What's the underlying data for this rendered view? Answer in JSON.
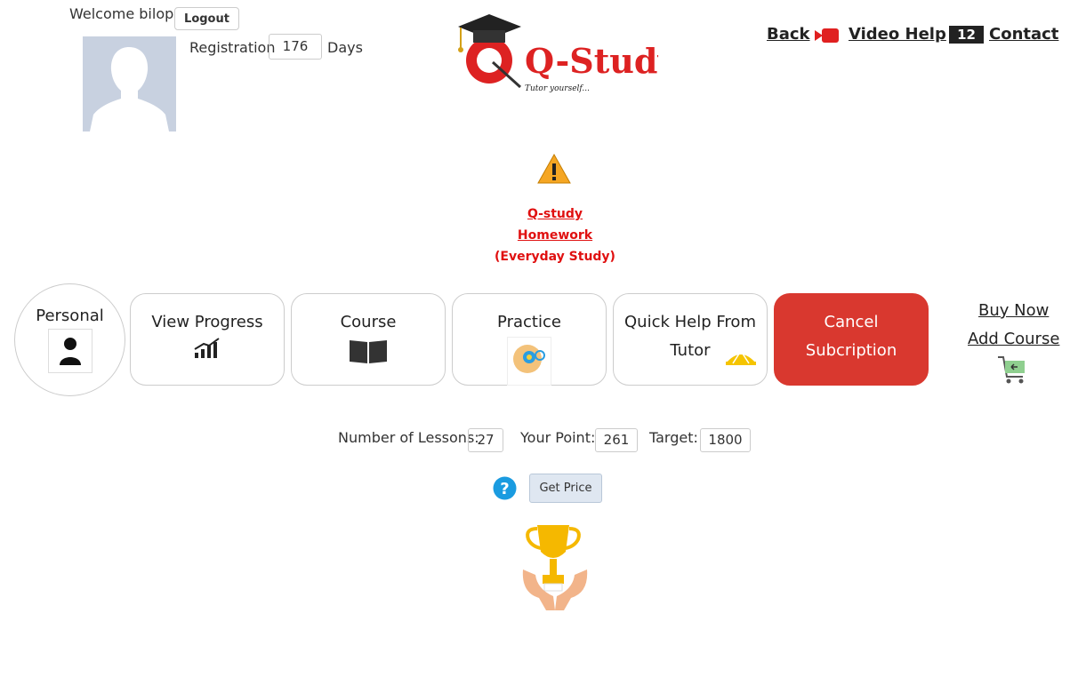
{
  "header": {
    "welcome": "Welcome bilop",
    "logout": "Logout",
    "registration_label": "Registration",
    "registration_days": "176",
    "days_label": "Days",
    "back": "Back",
    "video_help": "Video Help",
    "video_count": "12",
    "contact": "Contact",
    "logo_title": "Q-Study",
    "logo_tagline": "Tutor yourself..."
  },
  "homework": {
    "line1": "Q-study",
    "line2": "Homework",
    "line3": "(Everyday Study)"
  },
  "menu": {
    "personal": "Personal",
    "view_progress": "View Progress",
    "course": "Course",
    "practice": "Practice",
    "quick_help_1": "Quick Help From",
    "quick_help_2": "Tutor",
    "cancel_1": "Cancel",
    "cancel_2": "Subcription",
    "buy_now": "Buy Now",
    "add_course": "Add Course"
  },
  "stats": {
    "lessons_label": "Number of Lessons:",
    "lessons": "27",
    "point_label": "Your Point:",
    "point": "261",
    "target_label": "Target:",
    "target": "1800"
  },
  "price": {
    "button": "Get Price"
  },
  "colors": {
    "accent_red": "#d9382f",
    "link_red": "#e01010",
    "help_blue": "#1a9be0"
  },
  "icons": [
    "avatar-placeholder",
    "logo",
    "video-icon",
    "warning-icon",
    "person-icon",
    "chart-icon",
    "book-icon",
    "idea-icon",
    "tutor-icon",
    "cart-icon",
    "help-icon",
    "trophy-icon"
  ]
}
